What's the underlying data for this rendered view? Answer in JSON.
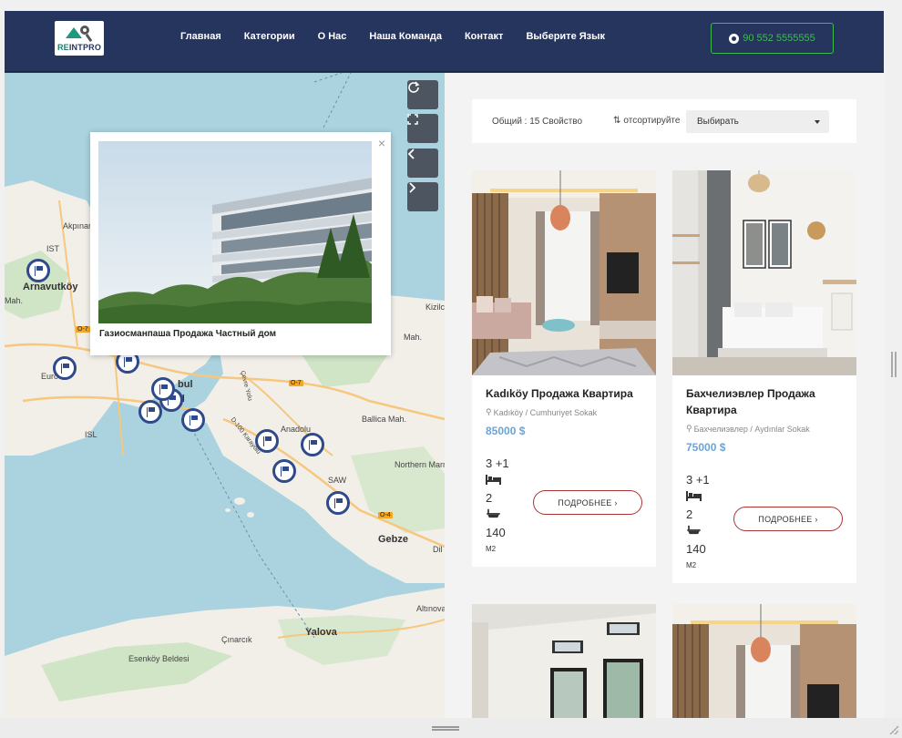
{
  "header": {
    "logo_text_re": "RE",
    "logo_text_intpro": "INTPRO",
    "nav": [
      "Главная",
      "Категории",
      "О Нас",
      "Наша Команда",
      "Контакт",
      "Выберите Язык"
    ],
    "phone": "90 552 5555555",
    "phone_icon": "whatsapp-icon",
    "colors": {
      "background": "#26355e",
      "phone_accent": "#3dbb4f"
    }
  },
  "map": {
    "labels": [
      "Akpınar",
      "IST",
      "Arnavutköy",
      "Mah.",
      "Kizilc",
      "Mah.",
      "Ballica Mah.",
      "Anadolu",
      "Northern Marm",
      "SAW",
      "Gebze",
      "Dil",
      "Altınova",
      "Yalova",
      "Çınarcık",
      "Esenköy Beldesi",
      "ISL",
      "Euro",
      "bul",
      "ul",
      "D-100 Karayolu",
      "Çevre Yolu"
    ],
    "road_labels": [
      "O-7",
      "O-7",
      "O-4"
    ],
    "controls": [
      "refresh-icon",
      "fullscreen-icon",
      "chevron-left-icon",
      "chevron-right-icon"
    ],
    "popup": {
      "title": "Газиосманпаша Продажа Частный дом",
      "close": "×"
    }
  },
  "listing": {
    "total": "Общий : 15 Свойство",
    "sort_label": "отсортируйте",
    "select_value": "Выбирать",
    "cards": [
      {
        "title": "Kadıköy Продажа Квартира",
        "location": "Kadıköy / Cumhuriyet Sokak",
        "price": "85000 $",
        "rooms": "3 +1",
        "beds": "2",
        "area": "140",
        "area_unit": "M2",
        "button": "ПОДРОБНЕЕ ›"
      },
      {
        "title": "Бахчелиэвлер Продажа Квартира",
        "location": "Бахчелиэвлер / Aydınlar Sokak",
        "price": "75000 $",
        "rooms": "3 +1",
        "beds": "2",
        "area": "140",
        "area_unit": "M2",
        "button": "ПОДРОБНЕЕ ›"
      }
    ],
    "colors": {
      "price": "#6aa3d8",
      "button_border": "#a33"
    }
  }
}
